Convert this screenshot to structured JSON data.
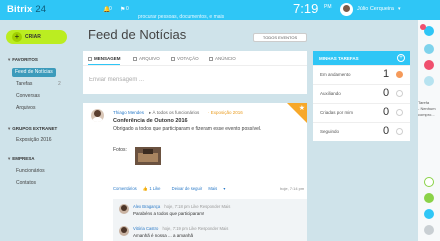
{
  "header": {
    "logo_main": "Bitrix",
    "logo_num": "24",
    "notifications_count": "0",
    "flags_count": "0",
    "search_placeholder": "procurar pessoas, documentos, e mais",
    "clock": "7:19",
    "clock_suffix": "PM",
    "user_name": "Júlio Cerqueira"
  },
  "sidebar": {
    "create_label": "CRIAR",
    "sections": [
      {
        "title": "FAVORITOS",
        "items": [
          "Feed de Notícias",
          "Tarefas",
          "Conversas",
          "Arquivos"
        ]
      },
      {
        "title": "GRUPOS EXTRANET",
        "items": [
          "Exposição 2016"
        ]
      },
      {
        "title": "EMPRESA",
        "items": [
          "Funcionários",
          "Contatos"
        ]
      }
    ],
    "tarefas_count": "2"
  },
  "main": {
    "title": "Feed de Notícias",
    "filter_label": "TODOS EVENTOS",
    "composer": {
      "tabs": [
        "MENSAGEM",
        "ARQUIVO",
        "VOTAÇÃO",
        "ANÚNCIO"
      ],
      "placeholder": "Enviar mensagem ..."
    },
    "post": {
      "author": "Thiago Mendes",
      "to_text": "À todos os funcionários",
      "to_group": "Exposição 2016",
      "title": "Conferência de Outono 2016",
      "text": "Obrigado a todos que participaram e fizeram esse evento possível.",
      "photos_label": "Fotos",
      "actions": [
        "Comentários",
        "1 Like",
        "Deixar de seguir",
        "Mais"
      ],
      "time": "hoje, 7:14 pm",
      "comments": [
        {
          "name": "Alex Bragança",
          "meta": "hoje, 7:18 pm   Like   Responder   Mais",
          "text": "Parabéns a todos que participaram!"
        },
        {
          "name": "Vitória Castro",
          "meta": "hoje, 7:19 pm   Like   Responder   Mais",
          "text": "Amanhã é nossa ... a amanhã"
        }
      ]
    }
  },
  "tasks": {
    "title": "MINHAS TAREFAS",
    "rows": [
      {
        "label": "Em andamento",
        "value": "1"
      },
      {
        "label": "Auxiliando",
        "value": "0"
      },
      {
        "label": "Criadas por mim",
        "value": "0"
      },
      {
        "label": "Seguindo",
        "value": "0"
      }
    ]
  },
  "rail": {
    "side_text_1": "Tarefa",
    "side_text_2": "- Nenhum",
    "side_text_3": "compro..."
  },
  "colors": {
    "accent": "#2fc6f6",
    "create": "#bbed21",
    "star": "#f7a82a"
  }
}
